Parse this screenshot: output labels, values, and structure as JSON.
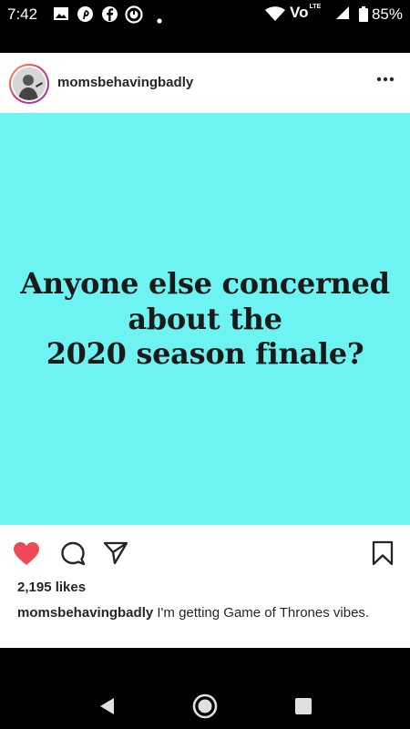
{
  "status_bar": {
    "time": "7:42",
    "notification_icons": [
      "image-icon",
      "pinterest-icon",
      "facebook-icon",
      "circle-icon",
      "dot-icon"
    ],
    "system_icons": [
      "wifi-icon",
      "volte-icon",
      "signal-icon",
      "battery-icon"
    ],
    "network_label": "Vo",
    "lte_label": "LTE",
    "battery": "85%"
  },
  "post": {
    "username": "momsbehavingbadly",
    "image_lines": [
      "Anyone else concerned",
      "about the",
      "2020 season finale?"
    ],
    "image_bg": "#6cf3f2",
    "likes": "2,195 likes",
    "caption_user": "momsbehavingbadly",
    "caption_text": "I'm getting Game of Thrones vibes.",
    "liked": true,
    "like_color": "#ed4956"
  },
  "nav_bar": {
    "buttons": [
      "back-icon",
      "home-icon",
      "recents-icon"
    ]
  }
}
